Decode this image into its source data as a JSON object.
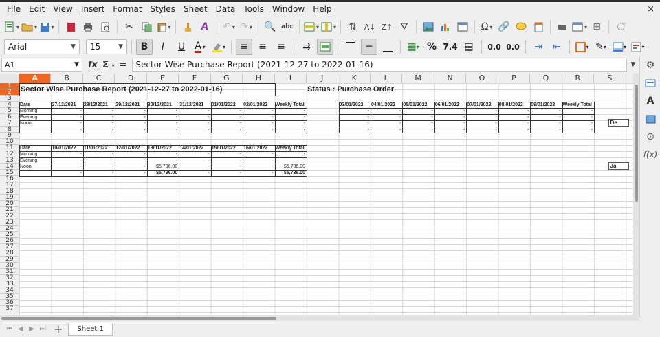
{
  "menu": [
    "File",
    "Edit",
    "View",
    "Insert",
    "Format",
    "Styles",
    "Sheet",
    "Data",
    "Tools",
    "Window",
    "Help"
  ],
  "close_glyph": "×",
  "toolbar2": {
    "font_name": "Arial",
    "font_size": "15",
    "number_format": "7.4",
    "currency": "%"
  },
  "formula": {
    "cell_ref": "A1",
    "content": "Sector Wise Purchase Report (2021-12-27 to 2022-01-16)"
  },
  "columns": [
    "A",
    "B",
    "C",
    "D",
    "E",
    "F",
    "G",
    "H",
    "I",
    "J",
    "K",
    "L",
    "M",
    "N",
    "O",
    "P",
    "Q",
    "R",
    "S"
  ],
  "rows": [
    "1",
    "2",
    "3",
    "4",
    "5",
    "6",
    "7",
    "8",
    "9",
    "10",
    "11",
    "12",
    "13",
    "14",
    "15",
    "16",
    "17",
    "18",
    "19",
    "20",
    "21",
    "22",
    "23",
    "24",
    "25",
    "26",
    "27",
    "28",
    "29",
    "30",
    "31",
    "32",
    "33",
    "34",
    "35",
    "36",
    "37"
  ],
  "report": {
    "title": "Sector Wise Purchase Report (2021-12-27 to 2022-01-16)",
    "status": "Status : Purchase Order",
    "week1": {
      "date_label": "Date",
      "dates": [
        "27/12/2021",
        "28/12/2021",
        "29/12/2021",
        "30/12/2021",
        "31/12/2021",
        "01/01/2022",
        "02/01/2022"
      ],
      "total_label": "Weekly Total",
      "rows": [
        {
          "label": "Morning",
          "values": [
            "-",
            "-",
            "-",
            "-",
            "-",
            "-",
            "-",
            "-"
          ]
        },
        {
          "label": "Evening",
          "values": [
            "-",
            "-",
            "-",
            "-",
            "-",
            "-",
            "-",
            "-"
          ]
        },
        {
          "label": "Noon",
          "values": [
            "-",
            "-",
            "-",
            "-",
            "-",
            "-",
            "-",
            "-"
          ]
        },
        {
          "label": "",
          "values": [
            "-",
            "-",
            "-",
            "-",
            "-",
            "-",
            "-",
            "-"
          ]
        }
      ]
    },
    "week2": {
      "dates": [
        "03/01/2022",
        "04/01/2022",
        "05/01/2022",
        "06/01/2022",
        "07/01/2022",
        "08/01/2022",
        "09/01/2022"
      ],
      "total_label": "Weekly Total",
      "rows": [
        {
          "values": [
            "-",
            "-",
            "-",
            "-",
            "-",
            "-",
            "-",
            "-"
          ]
        },
        {
          "values": [
            "-",
            "-",
            "-",
            "-",
            "-",
            "-",
            "-",
            "-"
          ]
        },
        {
          "values": [
            "-",
            "-",
            "-",
            "-",
            "-",
            "-",
            "-",
            "-"
          ]
        },
        {
          "values": [
            "-",
            "-",
            "-",
            "-",
            "-",
            "-",
            "-",
            "-"
          ]
        }
      ]
    },
    "week3": {
      "date_label": "Date",
      "dates": [
        "10/01/2022",
        "11/01/2022",
        "12/01/2022",
        "13/01/2022",
        "14/01/2022",
        "15/01/2022",
        "16/01/2022"
      ],
      "total_label": "Weekly Total",
      "rows": [
        {
          "label": "Morning",
          "values": [
            "-",
            "-",
            "-",
            "-",
            "-",
            "-",
            "-",
            "-"
          ]
        },
        {
          "label": "Evening",
          "values": [
            "-",
            "-",
            "-",
            "-",
            "-",
            "-",
            "-",
            "-"
          ]
        },
        {
          "label": "Noon",
          "values": [
            "-",
            "-",
            "-",
            "$5,736.00",
            "-",
            "-",
            "-",
            "$5,736.00"
          ]
        },
        {
          "label": "",
          "values": [
            "-",
            "-",
            "-",
            "$5,736.00",
            "-",
            "-",
            "-",
            "$5,736.00"
          ]
        }
      ]
    },
    "side_labels": [
      "De",
      "Ja"
    ]
  },
  "sheet_tab": "Sheet 1"
}
